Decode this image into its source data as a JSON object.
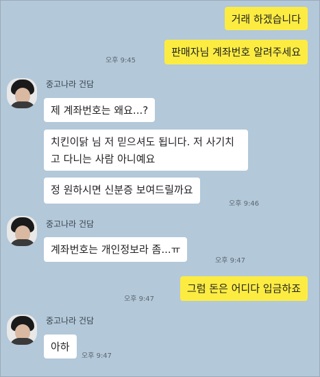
{
  "messages": {
    "m1": {
      "text": "거래 하겠습니다"
    },
    "m2": {
      "text": "판매자님 계좌번호 알려주세요",
      "time": "오후 9:45"
    },
    "m3": {
      "sender": "중고나라 건담",
      "text": "제 계좌번호는 왜요...?"
    },
    "m4": {
      "text": "치킨이닭 님 저 믿으셔도 됩니다. 저 사기치고 다니는 사람 아니예요"
    },
    "m5": {
      "text": "정 원하시면 신분증 보여드릴까요",
      "time": "오후 9:46"
    },
    "m6": {
      "sender": "중고나라 건담",
      "text": "계좌번호는 개인정보라 좀...ㅠ",
      "time": "오후 9:47"
    },
    "m7": {
      "text": "그럼 돈은 어디다 입금하죠",
      "time": "오후 9:47"
    },
    "m8": {
      "sender": "중고나라 건담",
      "text": "아하",
      "time": "오후 9:47"
    }
  },
  "colors": {
    "chat_background": "#b3c8d9",
    "my_bubble": "#fcec42",
    "their_bubble": "#ffffff"
  },
  "icons": {
    "avatar": "profile-photo-avatar"
  }
}
